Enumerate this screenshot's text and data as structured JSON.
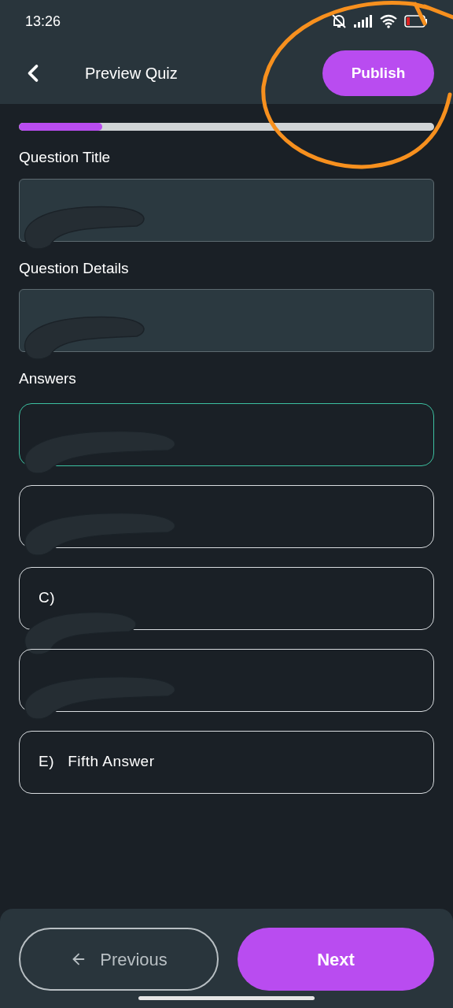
{
  "status_bar": {
    "time": "13:26"
  },
  "header": {
    "title": "Preview Quiz",
    "publish_button": "Publish"
  },
  "progress": {
    "level": 0.2
  },
  "question_title": {
    "label": "Question Title",
    "redacted": true
  },
  "question_details": {
    "label": "Question Details",
    "redacted": true
  },
  "answers_heading": "Answers",
  "answers": [
    {
      "selected": true,
      "redacted": true
    },
    {
      "selected": false,
      "redacted": true
    },
    {
      "text": "C)",
      "selected": false,
      "redacted": true
    },
    {
      "selected": false,
      "redacted": true
    },
    {
      "text": "E)   Fifth Answer",
      "selected": false,
      "redacted": false
    }
  ],
  "footer": {
    "previous_button": "Previous",
    "next_button": "Next"
  }
}
